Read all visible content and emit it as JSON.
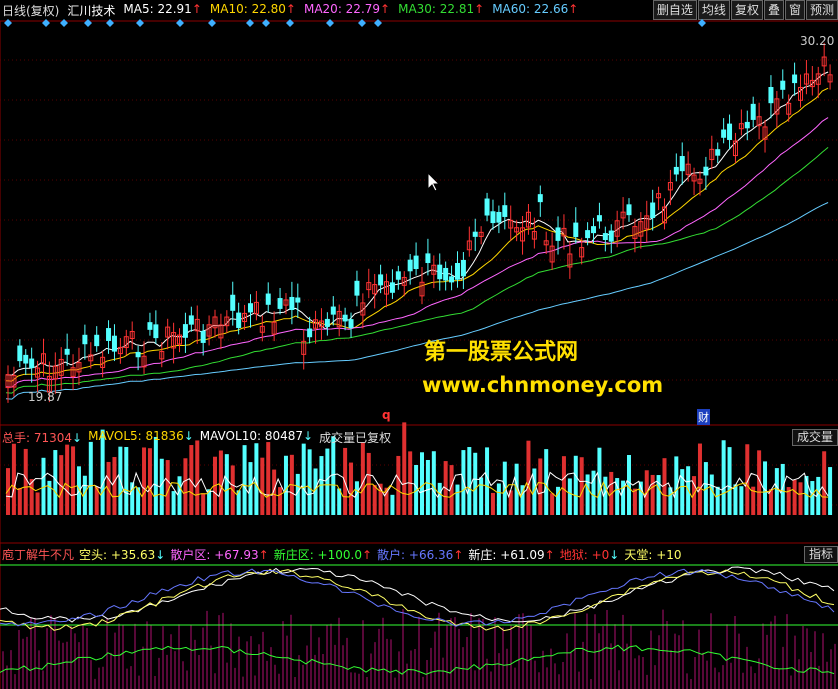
{
  "header": {
    "chart_name": "日线(复权)",
    "stock": "汇川技术",
    "ma": [
      {
        "label": "MA5: 22.91",
        "arrow": "↑",
        "color": "#ffffff"
      },
      {
        "label": "MA10: 22.80",
        "arrow": "↑",
        "color": "#ffd700"
      },
      {
        "label": "MA20: 22.79",
        "arrow": "↑",
        "color": "#ff66ff"
      },
      {
        "label": "MA30: 22.81",
        "arrow": "↑",
        "color": "#33dd33"
      },
      {
        "label": "MA60: 22.66",
        "arrow": "↑",
        "color": "#66ccff"
      }
    ]
  },
  "toolbar": [
    "删自选",
    "均线",
    "复权",
    "叠",
    "窗",
    "预测"
  ],
  "price_panel": {
    "high_label": "30.20",
    "low_label": "19.87",
    "marker_q": "q",
    "marker_cai": "财"
  },
  "watermark": {
    "line1": "第一股票公式网",
    "line2": "www.chnmoney.com"
  },
  "volume_panel": {
    "label": "总手: 71304",
    "label_arrow": "↓",
    "mavol5": "MAVOL5: 81836",
    "mavol5_arrow": "↓",
    "mavol10": "MAVOL10: 80487",
    "mavol10_arrow": "↓",
    "note": "成交量已复权",
    "right_tag": "成交量"
  },
  "indicator_panel": {
    "name": "庖丁解牛不凡",
    "items": [
      {
        "label": "空头: +35.63",
        "arrow": "↓",
        "color": "#ffff66"
      },
      {
        "label": "散户区: +67.93",
        "arrow": "↑",
        "color": "#ff66ff"
      },
      {
        "label": "新庄区: +100.0",
        "arrow": "↑",
        "color": "#33ff33"
      },
      {
        "label": "散户: +66.36",
        "arrow": "↑",
        "color": "#6677ff"
      },
      {
        "label": "新庄: +61.09",
        "arrow": "↑",
        "color": "#ffffff"
      },
      {
        "label": "地狱: +0",
        "arrow": "↓",
        "color": "#ff3333"
      },
      {
        "label": "天堂: +10",
        "arrow": "",
        "color": "#ffff66"
      }
    ],
    "right_tag": "指标"
  },
  "colors": {
    "up": "#ff3333",
    "down": "#54ffff",
    "grid": "#8b0000"
  }
}
